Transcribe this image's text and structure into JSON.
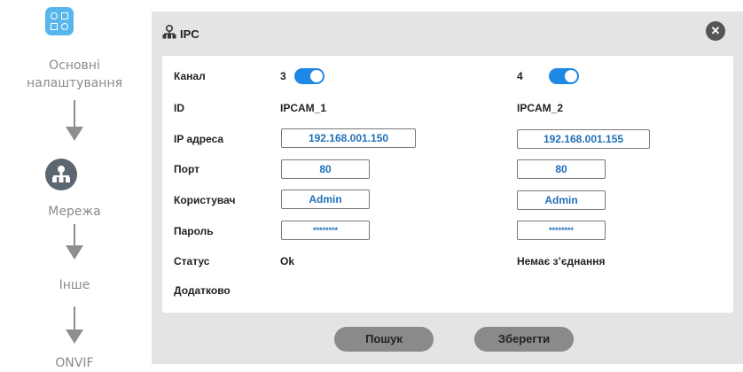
{
  "wizard": {
    "steps": [
      {
        "label_line1": "Основні",
        "label_line2": "налаштування",
        "icon": "settings-grid-icon"
      },
      {
        "label": "Мережа",
        "icon": "network-icon"
      },
      {
        "label": "Інше"
      },
      {
        "label": "ONVIF"
      }
    ]
  },
  "dialog": {
    "title": "IPC",
    "close_glyph": "✕",
    "labels": {
      "channel": "Канал",
      "id": "ID",
      "ip": "IP адреса",
      "port": "Порт",
      "user": "Користувач",
      "password": "Пароль",
      "status": "Статус",
      "extra": "Додатково"
    },
    "cameras": [
      {
        "channel": "3",
        "enabled": true,
        "id": "IPCAM_1",
        "ip": "192.168.001.150",
        "port": "80",
        "user": "Admin",
        "password": "********",
        "status": "Ok"
      },
      {
        "channel": "4",
        "enabled": true,
        "id": "IPCAM_2",
        "ip": "192.168.001.155",
        "port": "80",
        "user": "Admin",
        "password": "********",
        "status": "Немає з’єднання"
      }
    ],
    "buttons": {
      "search": "Пошук",
      "save": "Зберегти"
    }
  },
  "colors": {
    "accent": "#1e88e5",
    "field_text": "#1f6fb8",
    "wizard_active": "#57b6ee"
  }
}
